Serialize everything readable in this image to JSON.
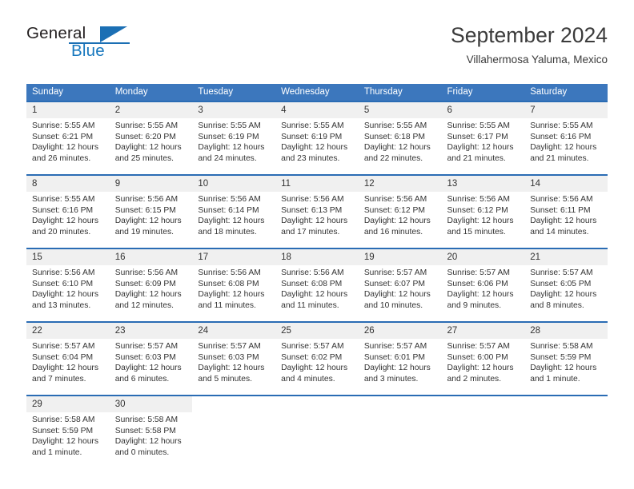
{
  "brand": {
    "name_part1": "General",
    "name_part2": "Blue",
    "logo_icon": "triangle-flag-icon"
  },
  "header": {
    "title": "September 2024",
    "location": "Villahermosa Yaluma, Mexico"
  },
  "colors": {
    "header_blue": "#3c77bd",
    "row_divider_blue": "#2a6cb4",
    "daynum_background": "#f0f0f0",
    "brand_blue": "#1878be",
    "text": "#333333"
  },
  "weekday_headers": [
    "Sunday",
    "Monday",
    "Tuesday",
    "Wednesday",
    "Thursday",
    "Friday",
    "Saturday"
  ],
  "weeks": [
    [
      {
        "day": "1",
        "sunrise": "Sunrise: 5:55 AM",
        "sunset": "Sunset: 6:21 PM",
        "daylight_line1": "Daylight: 12 hours",
        "daylight_line2": "and 26 minutes."
      },
      {
        "day": "2",
        "sunrise": "Sunrise: 5:55 AM",
        "sunset": "Sunset: 6:20 PM",
        "daylight_line1": "Daylight: 12 hours",
        "daylight_line2": "and 25 minutes."
      },
      {
        "day": "3",
        "sunrise": "Sunrise: 5:55 AM",
        "sunset": "Sunset: 6:19 PM",
        "daylight_line1": "Daylight: 12 hours",
        "daylight_line2": "and 24 minutes."
      },
      {
        "day": "4",
        "sunrise": "Sunrise: 5:55 AM",
        "sunset": "Sunset: 6:19 PM",
        "daylight_line1": "Daylight: 12 hours",
        "daylight_line2": "and 23 minutes."
      },
      {
        "day": "5",
        "sunrise": "Sunrise: 5:55 AM",
        "sunset": "Sunset: 6:18 PM",
        "daylight_line1": "Daylight: 12 hours",
        "daylight_line2": "and 22 minutes."
      },
      {
        "day": "6",
        "sunrise": "Sunrise: 5:55 AM",
        "sunset": "Sunset: 6:17 PM",
        "daylight_line1": "Daylight: 12 hours",
        "daylight_line2": "and 21 minutes."
      },
      {
        "day": "7",
        "sunrise": "Sunrise: 5:55 AM",
        "sunset": "Sunset: 6:16 PM",
        "daylight_line1": "Daylight: 12 hours",
        "daylight_line2": "and 21 minutes."
      }
    ],
    [
      {
        "day": "8",
        "sunrise": "Sunrise: 5:55 AM",
        "sunset": "Sunset: 6:16 PM",
        "daylight_line1": "Daylight: 12 hours",
        "daylight_line2": "and 20 minutes."
      },
      {
        "day": "9",
        "sunrise": "Sunrise: 5:56 AM",
        "sunset": "Sunset: 6:15 PM",
        "daylight_line1": "Daylight: 12 hours",
        "daylight_line2": "and 19 minutes."
      },
      {
        "day": "10",
        "sunrise": "Sunrise: 5:56 AM",
        "sunset": "Sunset: 6:14 PM",
        "daylight_line1": "Daylight: 12 hours",
        "daylight_line2": "and 18 minutes."
      },
      {
        "day": "11",
        "sunrise": "Sunrise: 5:56 AM",
        "sunset": "Sunset: 6:13 PM",
        "daylight_line1": "Daylight: 12 hours",
        "daylight_line2": "and 17 minutes."
      },
      {
        "day": "12",
        "sunrise": "Sunrise: 5:56 AM",
        "sunset": "Sunset: 6:12 PM",
        "daylight_line1": "Daylight: 12 hours",
        "daylight_line2": "and 16 minutes."
      },
      {
        "day": "13",
        "sunrise": "Sunrise: 5:56 AM",
        "sunset": "Sunset: 6:12 PM",
        "daylight_line1": "Daylight: 12 hours",
        "daylight_line2": "and 15 minutes."
      },
      {
        "day": "14",
        "sunrise": "Sunrise: 5:56 AM",
        "sunset": "Sunset: 6:11 PM",
        "daylight_line1": "Daylight: 12 hours",
        "daylight_line2": "and 14 minutes."
      }
    ],
    [
      {
        "day": "15",
        "sunrise": "Sunrise: 5:56 AM",
        "sunset": "Sunset: 6:10 PM",
        "daylight_line1": "Daylight: 12 hours",
        "daylight_line2": "and 13 minutes."
      },
      {
        "day": "16",
        "sunrise": "Sunrise: 5:56 AM",
        "sunset": "Sunset: 6:09 PM",
        "daylight_line1": "Daylight: 12 hours",
        "daylight_line2": "and 12 minutes."
      },
      {
        "day": "17",
        "sunrise": "Sunrise: 5:56 AM",
        "sunset": "Sunset: 6:08 PM",
        "daylight_line1": "Daylight: 12 hours",
        "daylight_line2": "and 11 minutes."
      },
      {
        "day": "18",
        "sunrise": "Sunrise: 5:56 AM",
        "sunset": "Sunset: 6:08 PM",
        "daylight_line1": "Daylight: 12 hours",
        "daylight_line2": "and 11 minutes."
      },
      {
        "day": "19",
        "sunrise": "Sunrise: 5:57 AM",
        "sunset": "Sunset: 6:07 PM",
        "daylight_line1": "Daylight: 12 hours",
        "daylight_line2": "and 10 minutes."
      },
      {
        "day": "20",
        "sunrise": "Sunrise: 5:57 AM",
        "sunset": "Sunset: 6:06 PM",
        "daylight_line1": "Daylight: 12 hours",
        "daylight_line2": "and 9 minutes."
      },
      {
        "day": "21",
        "sunrise": "Sunrise: 5:57 AM",
        "sunset": "Sunset: 6:05 PM",
        "daylight_line1": "Daylight: 12 hours",
        "daylight_line2": "and 8 minutes."
      }
    ],
    [
      {
        "day": "22",
        "sunrise": "Sunrise: 5:57 AM",
        "sunset": "Sunset: 6:04 PM",
        "daylight_line1": "Daylight: 12 hours",
        "daylight_line2": "and 7 minutes."
      },
      {
        "day": "23",
        "sunrise": "Sunrise: 5:57 AM",
        "sunset": "Sunset: 6:03 PM",
        "daylight_line1": "Daylight: 12 hours",
        "daylight_line2": "and 6 minutes."
      },
      {
        "day": "24",
        "sunrise": "Sunrise: 5:57 AM",
        "sunset": "Sunset: 6:03 PM",
        "daylight_line1": "Daylight: 12 hours",
        "daylight_line2": "and 5 minutes."
      },
      {
        "day": "25",
        "sunrise": "Sunrise: 5:57 AM",
        "sunset": "Sunset: 6:02 PM",
        "daylight_line1": "Daylight: 12 hours",
        "daylight_line2": "and 4 minutes."
      },
      {
        "day": "26",
        "sunrise": "Sunrise: 5:57 AM",
        "sunset": "Sunset: 6:01 PM",
        "daylight_line1": "Daylight: 12 hours",
        "daylight_line2": "and 3 minutes."
      },
      {
        "day": "27",
        "sunrise": "Sunrise: 5:57 AM",
        "sunset": "Sunset: 6:00 PM",
        "daylight_line1": "Daylight: 12 hours",
        "daylight_line2": "and 2 minutes."
      },
      {
        "day": "28",
        "sunrise": "Sunrise: 5:58 AM",
        "sunset": "Sunset: 5:59 PM",
        "daylight_line1": "Daylight: 12 hours",
        "daylight_line2": "and 1 minute."
      }
    ],
    [
      {
        "day": "29",
        "sunrise": "Sunrise: 5:58 AM",
        "sunset": "Sunset: 5:59 PM",
        "daylight_line1": "Daylight: 12 hours",
        "daylight_line2": "and 1 minute."
      },
      {
        "day": "30",
        "sunrise": "Sunrise: 5:58 AM",
        "sunset": "Sunset: 5:58 PM",
        "daylight_line1": "Daylight: 12 hours",
        "daylight_line2": "and 0 minutes."
      },
      {
        "day": "",
        "sunrise": "",
        "sunset": "",
        "daylight_line1": "",
        "daylight_line2": ""
      },
      {
        "day": "",
        "sunrise": "",
        "sunset": "",
        "daylight_line1": "",
        "daylight_line2": ""
      },
      {
        "day": "",
        "sunrise": "",
        "sunset": "",
        "daylight_line1": "",
        "daylight_line2": ""
      },
      {
        "day": "",
        "sunrise": "",
        "sunset": "",
        "daylight_line1": "",
        "daylight_line2": ""
      },
      {
        "day": "",
        "sunrise": "",
        "sunset": "",
        "daylight_line1": "",
        "daylight_line2": ""
      }
    ]
  ]
}
